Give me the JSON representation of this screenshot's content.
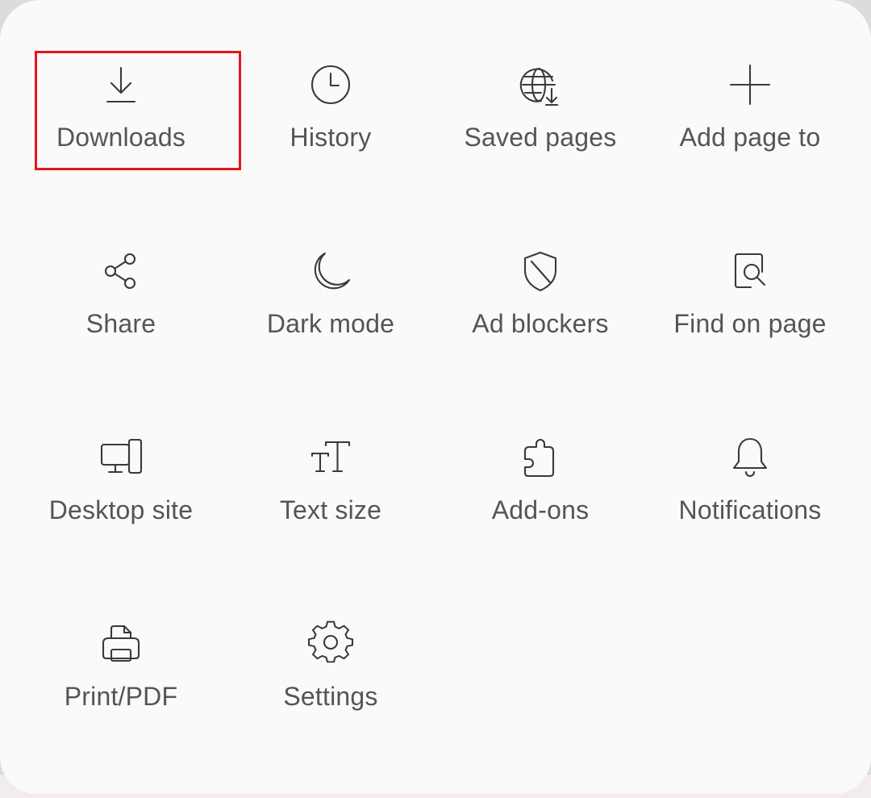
{
  "colors": {
    "highlight_border": "#e8141b",
    "icon_stroke": "#3a3a3a",
    "label_text": "#555555",
    "sheet_background": "#fafafa"
  },
  "menu": {
    "items": [
      {
        "label": "Downloads",
        "icon": "download-icon",
        "highlighted": true
      },
      {
        "label": "History",
        "icon": "clock-icon"
      },
      {
        "label": "Saved pages",
        "icon": "globe-download-icon"
      },
      {
        "label": "Add page to",
        "icon": "plus-icon"
      },
      {
        "label": "Share",
        "icon": "share-icon"
      },
      {
        "label": "Dark mode",
        "icon": "moon-icon"
      },
      {
        "label": "Ad blockers",
        "icon": "shield-icon"
      },
      {
        "label": "Find on page",
        "icon": "find-icon"
      },
      {
        "label": "Desktop site",
        "icon": "desktop-icon"
      },
      {
        "label": "Text size",
        "icon": "text-size-icon"
      },
      {
        "label": "Add-ons",
        "icon": "puzzle-icon"
      },
      {
        "label": "Notifications",
        "icon": "bell-icon"
      },
      {
        "label": "Print/PDF",
        "icon": "printer-icon"
      },
      {
        "label": "Settings",
        "icon": "gear-icon"
      }
    ]
  }
}
